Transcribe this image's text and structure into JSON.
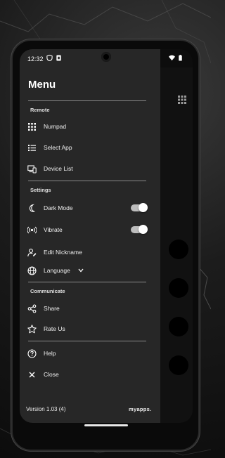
{
  "status_bar": {
    "time": "12:32",
    "icons": [
      "shield-icon",
      "sim-icon",
      "wifi-icon",
      "battery-icon"
    ]
  },
  "menu": {
    "title": "Menu"
  },
  "sections": {
    "remote": "Remote",
    "settings": "Settings",
    "communicate": "Communicate"
  },
  "items": {
    "numpad": "Numpad",
    "select_app": "Select App",
    "device_list": "Device List",
    "dark_mode": "Dark Mode",
    "vibrate": "Vibrate",
    "edit_nickname": "Edit Nickname",
    "language": "Language",
    "share": "Share",
    "rate_us": "Rate Us",
    "help": "Help",
    "close": "Close"
  },
  "toggles": {
    "dark_mode": true,
    "vibrate": true
  },
  "footer": {
    "version": "Version 1.03 (4)",
    "brand": "myapps."
  },
  "colors": {
    "drawer_bg": "#272727",
    "toggle_track": "#bdbdbd",
    "text": "#f0f0f0"
  }
}
